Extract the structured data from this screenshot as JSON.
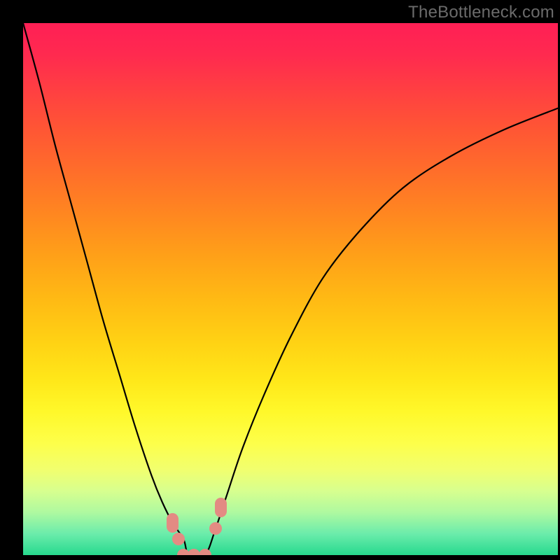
{
  "watermark": {
    "text": "TheBottleneck.com"
  },
  "colors": {
    "frame": "#000000",
    "curve_stroke": "#000000",
    "marker_fill": "#e38b83",
    "gradient_top": "#ff1f55",
    "gradient_bottom": "#27d98e"
  },
  "chart_data": {
    "type": "line",
    "title": "",
    "xlabel": "",
    "ylabel": "",
    "xlim": [
      0,
      100
    ],
    "ylim": [
      0,
      100
    ],
    "grid": false,
    "legend": false,
    "series": [
      {
        "name": "bottleneck-curve",
        "x": [
          0,
          3,
          6,
          9,
          12,
          15,
          18,
          21,
          24,
          26,
          28,
          30,
          31,
          34,
          36,
          38,
          41,
          45,
          50,
          56,
          63,
          71,
          80,
          90,
          100
        ],
        "values": [
          100,
          89,
          77,
          66,
          55,
          44,
          34,
          24,
          15,
          10,
          6,
          3,
          0,
          0,
          5,
          11,
          20,
          30,
          41,
          52,
          61,
          69,
          75,
          80,
          84
        ]
      }
    ],
    "annotations": [
      {
        "name": "marker-left-floor-a",
        "x": 28,
        "y": 6
      },
      {
        "name": "marker-left-floor-b",
        "x": 29,
        "y": 3
      },
      {
        "name": "marker-floor-a",
        "x": 30,
        "y": 0
      },
      {
        "name": "marker-floor-b",
        "x": 32,
        "y": 0
      },
      {
        "name": "marker-floor-c",
        "x": 34,
        "y": 0
      },
      {
        "name": "marker-right-floor-a",
        "x": 36,
        "y": 5
      },
      {
        "name": "marker-right-floor-b",
        "x": 37,
        "y": 9
      }
    ]
  }
}
